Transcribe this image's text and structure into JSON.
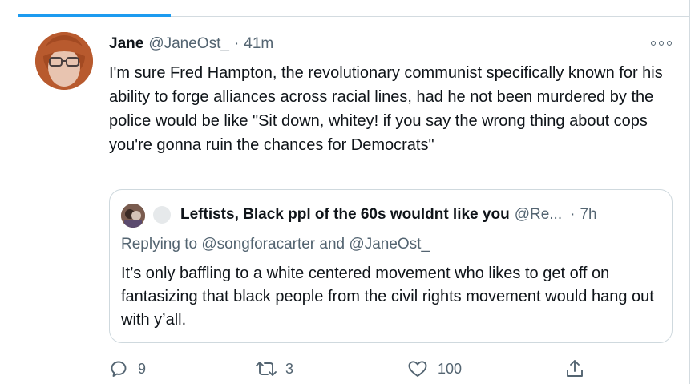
{
  "tweet": {
    "author_name": "Jane",
    "author_handle": "@JaneOst_",
    "separator": "·",
    "time": "41m",
    "text": "I'm sure Fred Hampton, the revolutionary communist specifically known for his ability to forge alliances across racial lines, had he not been murdered by the police would be like \"Sit down, whitey! if you say the wrong thing about cops you're gonna ruin the chances for Democrats\""
  },
  "quoted_tweet": {
    "author_name": "Leftists, Black ppl of the 60s wouldnt like you",
    "author_handle": "@Re...",
    "separator": "·",
    "time": "7h",
    "replying_prefix": "Replying to",
    "replying_to_1": "@songforacarter",
    "replying_and": "and",
    "replying_to_2": "@JaneOst_",
    "text": "It’s only baffling to a white centered movement who likes to get off on fantasizing that black people from the civil rights movement would hang out with y’all."
  },
  "actions": {
    "reply_count": "9",
    "retweet_count": "3",
    "like_count": "100"
  },
  "icons": [
    "more-icon",
    "reply-icon",
    "retweet-icon",
    "like-icon",
    "share-icon"
  ],
  "colors": {
    "accent": "#1d9bf0",
    "secondary_text": "#536471",
    "border": "#cfd9de"
  }
}
